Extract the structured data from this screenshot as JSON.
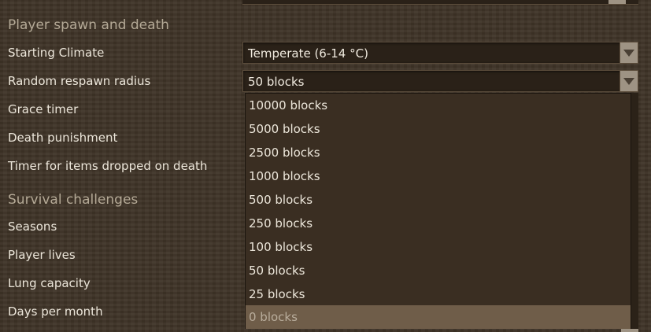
{
  "sections": {
    "player_spawn": "Player spawn and death",
    "survival": "Survival challenges"
  },
  "settings": {
    "starting_climate": {
      "label": "Starting Climate",
      "value": "Temperate (6-14 °C)"
    },
    "respawn_radius": {
      "label": "Random respawn radius",
      "value": "50 blocks"
    },
    "grace_timer": {
      "label": "Grace timer"
    },
    "death_punishment": {
      "label": "Death punishment"
    },
    "dropped_items_timer": {
      "label": "Timer for items dropped on death"
    },
    "seasons": {
      "label": "Seasons"
    },
    "player_lives": {
      "label": "Player lives"
    },
    "lung_capacity": {
      "label": "Lung capacity"
    },
    "days_per_month": {
      "label": "Days per month"
    }
  },
  "dropdown": {
    "options": [
      "10000 blocks",
      "5000 blocks",
      "2500 blocks",
      "1000 blocks",
      "500 blocks",
      "250 blocks",
      "100 blocks",
      "50 blocks",
      "25 blocks",
      "0 blocks"
    ],
    "highlighted": "0 blocks"
  },
  "icons": {
    "dropdown_arrow": "chevron-down-icon"
  },
  "colors": {
    "background": "#3f3428",
    "highlight": "#6f5d49",
    "arrow_box": "#9e9384"
  }
}
